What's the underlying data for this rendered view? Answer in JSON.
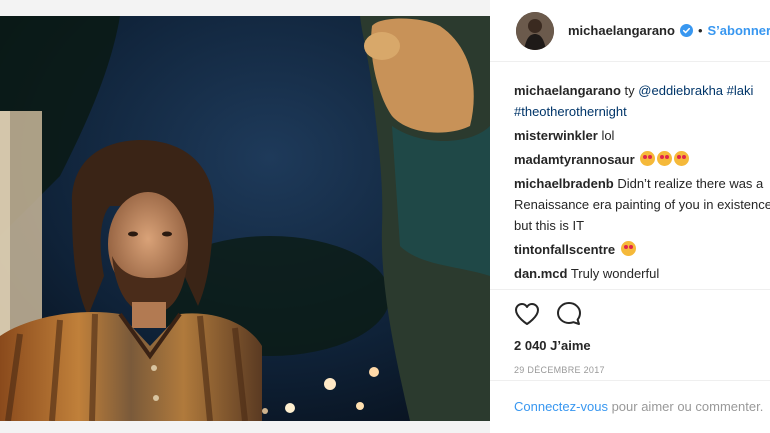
{
  "header": {
    "username": "michaelangarano",
    "dot": "•",
    "follow_label": "S’abonner"
  },
  "comments": [
    {
      "user": "michaelangarano",
      "text_prefix": " ty ",
      "mention": "@eddiebrakha",
      "hashtags": " #laki",
      "hashtag2": "#theotherothernight"
    },
    {
      "user": "misterwinkler",
      "text": " lol"
    },
    {
      "user": "madamtyrannosaur",
      "emoji_count": 3
    },
    {
      "user": "michaelbradenb",
      "text": " Didn’t realize there was a Renaissance era painting of you in existence but this is IT"
    },
    {
      "user": "tintonfallscentre",
      "emoji_count": 1
    },
    {
      "user": "dan.mcd",
      "text": " Truly wonderful"
    }
  ],
  "post": {
    "likes": "2 040 J’aime",
    "date": "29 DÉCEMBRE 2017"
  },
  "login": {
    "link": "Connectez-vous",
    "rest": " pour aimer ou commenter."
  },
  "icons": {
    "like": "heart-icon",
    "comment": "comment-icon",
    "verified": "verified-badge-icon"
  },
  "colors": {
    "link": "#3897f0",
    "mention": "#003569",
    "muted": "#999999"
  }
}
